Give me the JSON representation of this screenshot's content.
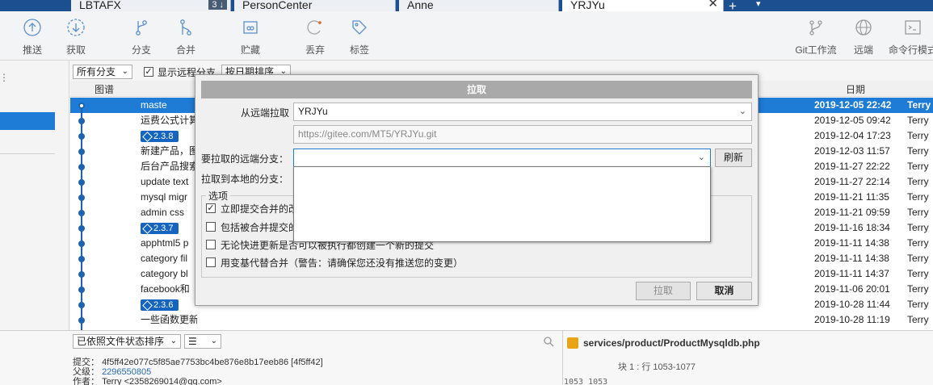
{
  "tabs": [
    {
      "label": "LBTAFX",
      "badge": "3 ↓"
    },
    {
      "label": "PersonCenter"
    },
    {
      "label": "Anne"
    },
    {
      "label": "YRJYu",
      "close": "✕"
    }
  ],
  "tab_actions": {
    "plus": "+",
    "caret": "▾"
  },
  "toolbar": {
    "push": "推送",
    "fetch": "获取",
    "branch": "分支",
    "merge": "合并",
    "stash": "贮藏",
    "discard": "丢弃",
    "tag": "标签",
    "gitflow": "Git工作流",
    "remote": "远端",
    "terminal": "命令行模式"
  },
  "filter": {
    "branches": "所有分支",
    "show_remote": "显示远程分支",
    "sort": "按日期排序"
  },
  "columns": {
    "graph": "图谱",
    "date": "日期"
  },
  "commits": [
    {
      "msg": "maste",
      "date": "2019-12-05 22:42",
      "author": "Terry",
      "selected": true
    },
    {
      "msg": "运费公式计算",
      "date": "2019-12-05 09:42",
      "author": "Terry"
    },
    {
      "tag": "2.3.8",
      "date": "2019-12-04 17:23",
      "author": "Terry"
    },
    {
      "msg": "新建产品，图",
      "date": "2019-12-03 11:57",
      "author": "Terry"
    },
    {
      "msg": "后台产品搜索",
      "date": "2019-11-27 22:22",
      "author": "Terry"
    },
    {
      "msg": "update text",
      "date": "2019-11-27 22:14",
      "author": "Terry"
    },
    {
      "msg": "mysql migr",
      "date": "2019-11-21 11:35",
      "author": "Terry"
    },
    {
      "msg": "admin css",
      "date": "2019-11-21 09:59",
      "author": "Terry"
    },
    {
      "tag": "2.3.7",
      "date": "2019-11-16 18:34",
      "author": "Terry"
    },
    {
      "msg": "apphtml5 p",
      "date": "2019-11-11 14:38",
      "author": "Terry"
    },
    {
      "msg": "category fil",
      "date": "2019-11-11 14:38",
      "author": "Terry"
    },
    {
      "msg": "category bl",
      "date": "2019-11-11 14:37",
      "author": "Terry"
    },
    {
      "msg": "facebook和",
      "date": "2019-11-06 20:01",
      "author": "Terry"
    },
    {
      "tag": "2.3.6",
      "date": "2019-10-28 11:44",
      "author": "Terry"
    },
    {
      "msg": "一些函数更新",
      "date": "2019-10-28 11:19",
      "author": "Terry"
    }
  ],
  "bottom": {
    "sort": "已依照文件状态排序",
    "view": "☰",
    "file": "services/product/ProductMysqldb.php",
    "hunk": "块 1 : 行 1053-1077",
    "linenos": "1053 1053",
    "commit_label": "提交：",
    "commit_value": "4f5ff42e077c5f85ae7753bc4be876e8b17eeb86 [4f5ff42]",
    "parent_label": "父级：",
    "parent_value": "2296550805",
    "author_label": "作者：",
    "author_value": "Terry <2358269014@qq.com>"
  },
  "dialog": {
    "title": "拉取",
    "remote_label": "从远端拉取",
    "remote_value": "YRJYu",
    "remote_url": "https://gitee.com/MT5/YRJYu.git",
    "branch_label": "要拉取的远端分支：",
    "branch_value": "",
    "refresh": "刷新",
    "local_label": "拉取到本地的分支：",
    "options_legend": "选项",
    "options": [
      {
        "label": "立即提交合并的改变",
        "checked": true
      },
      {
        "label": "包括被合并提交的信息",
        "checked": false
      },
      {
        "label": "无论快进更新是否可以被执行都创建一个新的提交",
        "checked": false
      },
      {
        "label": "用变基代替合并（警告：请确保您还没有推送您的变更）",
        "checked": false
      }
    ],
    "ok": "拉取",
    "cancel": "取消"
  },
  "colors": {
    "accent": "#1e7bd6",
    "tabbar": "#1c4f8f",
    "tag": "#1565c0"
  }
}
